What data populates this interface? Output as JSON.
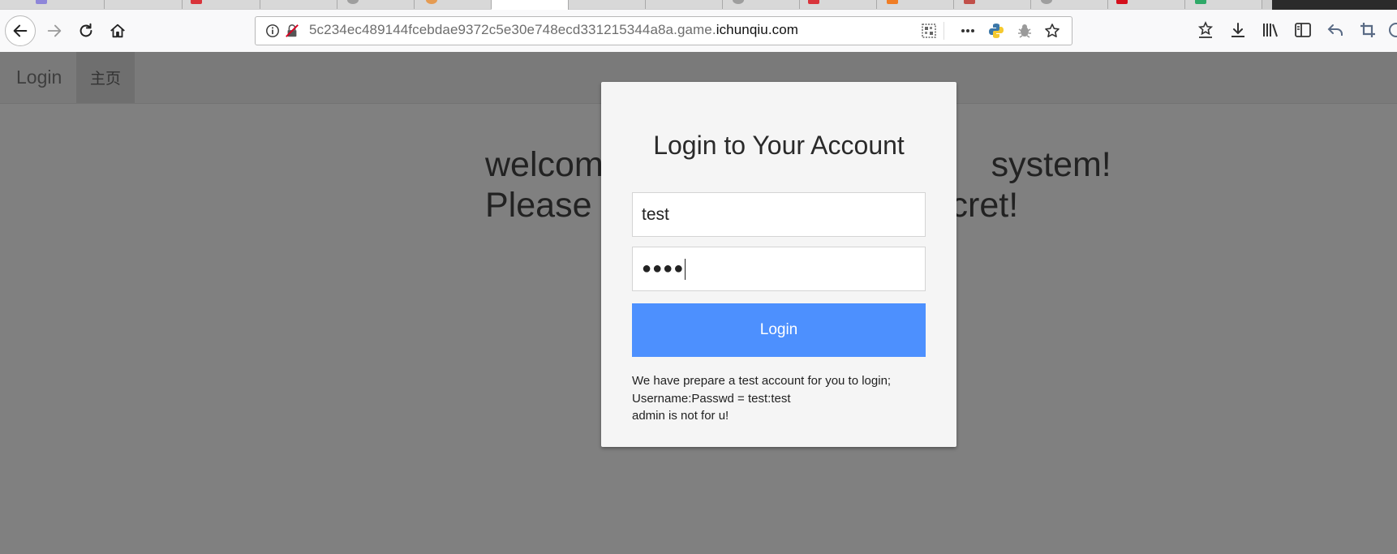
{
  "browser": {
    "url_prefix": "5c234ec489144fcebdae9372c5e30e748ecd331215344a8a.game.",
    "url_host": "ichunqiu.com",
    "tabs_count": 17
  },
  "site": {
    "brand": "Login",
    "home_link": "主页",
    "welcome_line1": "welcom                                        system!",
    "welcome_line2": "Please                                     cret!"
  },
  "modal": {
    "title": "Login to Your Account",
    "username_value": "test",
    "password_dots": "●●●●",
    "login_button": "Login",
    "help_line1": "We have prepare a test account for you to login;",
    "help_line2": "Username:Passwd = test:test",
    "help_line3": "admin is not for u!"
  },
  "colors": {
    "overlay": "#808080",
    "modal_bg": "#f5f5f5",
    "button": "#4d90fe"
  }
}
